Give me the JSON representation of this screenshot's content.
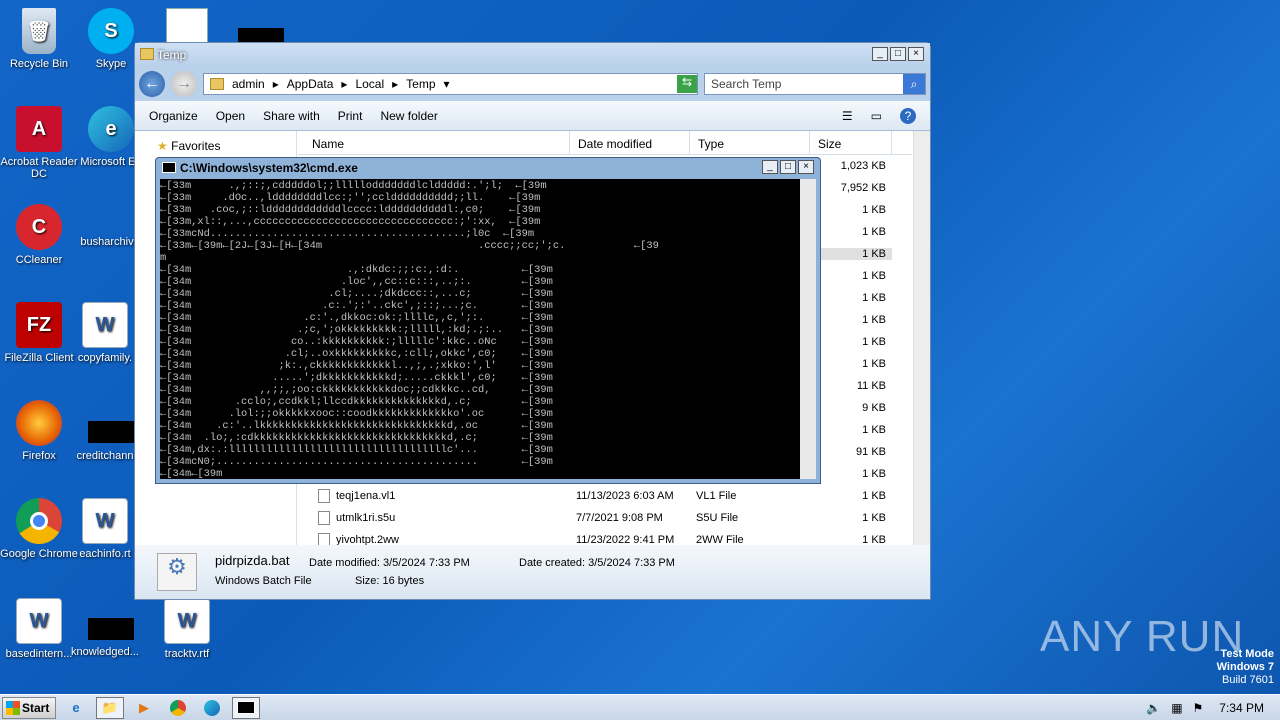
{
  "desktop_icons": [
    {
      "label": "Recycle Bin",
      "icon": "recycle-bin-icon"
    },
    {
      "label": "Skype",
      "icon": "skype-icon"
    },
    {
      "label": "Acrobat Reader DC",
      "icon": "acrobat-icon"
    },
    {
      "label": "Microsoft Ed",
      "icon": "edge-icon"
    },
    {
      "label": "CCleaner",
      "icon": "ccleaner-icon"
    },
    {
      "label": "busharchiv",
      "icon": "file-icon"
    },
    {
      "label": "FileZilla Client",
      "icon": "filezilla-icon"
    },
    {
      "label": "copyfamily.",
      "icon": "word-doc-icon"
    },
    {
      "label": "Firefox",
      "icon": "firefox-icon"
    },
    {
      "label": "creditchann",
      "icon": "file-icon"
    },
    {
      "label": "Google Chrome",
      "icon": "chrome-icon"
    },
    {
      "label": "eachinfo.rt",
      "icon": "word-doc-icon"
    },
    {
      "label": "basedintern...",
      "icon": "word-doc-icon"
    },
    {
      "label": "knowledged...",
      "icon": "file-icon"
    },
    {
      "label": "tracktv.rtf",
      "icon": "word-doc-icon"
    }
  ],
  "explorer": {
    "title": "Temp",
    "breadcrumb": [
      "admin",
      "AppData",
      "Local",
      "Temp"
    ],
    "search_placeholder": "Search Temp",
    "toolbar": {
      "organize": "Organize",
      "open": "Open",
      "share_with": "Share with",
      "print": "Print",
      "new_folder": "New folder"
    },
    "nav_favorites": "Favorites",
    "columns": {
      "name": "Name",
      "date": "Date modified",
      "type": "Type",
      "size": "Size"
    },
    "sizes_above": [
      "1,023 KB",
      "7,952 KB",
      "1 KB",
      "1 KB",
      "1 KB",
      "1 KB",
      "1 KB",
      "1 KB",
      "1 KB",
      "1 KB",
      "11 KB",
      "9 KB",
      "1 KB",
      "91 KB",
      "1 KB"
    ],
    "rows": [
      {
        "name": "teqj1ena.vl1",
        "date": "11/13/2023 6:03 AM",
        "type": "VL1 File",
        "size": "1 KB"
      },
      {
        "name": "utmlk1ri.s5u",
        "date": "7/7/2021 9:08 PM",
        "type": "S5U File",
        "size": "1 KB"
      },
      {
        "name": "yivohtpt.2ww",
        "date": "11/23/2022 9:41 PM",
        "type": "2WW File",
        "size": "1 KB"
      }
    ],
    "status": {
      "file_name": "pidrpizda.bat",
      "file_type": "Windows Batch File",
      "date_modified": "Date modified: 3/5/2024 7:33 PM",
      "date_created": "Date created: 3/5/2024 7:33 PM",
      "size": "Size: 16 bytes"
    }
  },
  "cmd": {
    "title": "C:\\Windows\\system32\\cmd.exe",
    "lines": [
      "←[33m      .,;::;,cdddddol;;lllllodddddddlclddddd:.';l;  ←[39m",
      "←[33m     .dOc..,lddddddddlcc:;'';ccldddddddddd;;ll.    ←[39m",
      "←[33m   .coc,;::lddddddddddddlcccc:lddddddddddl:,c0;    ←[39m",
      "←[33m,xl::,...,cccccccccccccccccccccccccccccccc:;':xx,  ←[39m",
      "←[33mcNd.........................................;l0c  ←[39m",
      "←[33m←[39m←[2J←[3J←[H←[34m                         .cccc;;cc;';c.           ←[39",
      "m",
      "←[34m                         .,:dkdc:;;:c:,:d:.          ←[39m",
      "←[34m                        .loc',,cc::c:::,..;:.        ←[39m",
      "←[34m                      .cl;....;dkdccc::,...c;        ←[39m",
      "←[34m                     .c:.';:'..ckc',;::;...;c.       ←[39m",
      "←[34m                  .c:'.,dkkoc:ok:;llllc,,c,';:.      ←[39m",
      "←[34m                 .;c,';okkkkkkkkk:;lllll,:kd;.;:..   ←[39m",
      "←[34m                co..:kkkkkkkkkk:;lllllc':kkc..oNc    ←[39m",
      "←[34m               .cl;..oxkkkkkkkkkc,:cll;,okkc',c0;    ←[39m",
      "←[34m              ;k:.,ckkkkkkkkkkkkl..,;,.;xkko:',l'    ←[39m",
      "←[34m             .....';dkkkkkkkkkkkd;.....ckkkl',c0;    ←[39m",
      "←[34m           ,,;;,;oo:ckkkkkkkkkkkdoc;;cdkkkc..cd,     ←[39m",
      "←[34m       .cclo;,ccdkkl;llccdkkkkkkkkkkkkkkd,.c;        ←[39m",
      "←[34m      .lol:;;okkkkkxooc::coodkkkkkkkkkkkkko'.oc      ←[39m",
      "←[34m    .c:'..lkkkkkkkkkkkkkkkkkkkkkkkkkkkkkkd,.oc       ←[39m",
      "←[34m  .lo;,:cdkkkkkkkkkkkkkkkkkkkkkkkkkkkkkkkd,.c;       ←[39m",
      "←[34m,dx:.:lllllllllllllllllllllllllllllllllllc'...       ←[39m",
      "←[34mcN0;..........................................       ←[39m",
      "←[34m←[39m"
    ]
  },
  "taskbar": {
    "start_label": "Start",
    "clock": "7:34 PM"
  },
  "watermark": {
    "line1": "Test Mode",
    "line2": "Windows 7",
    "line3": "Build 7601",
    "brand": "ANY RUN"
  }
}
